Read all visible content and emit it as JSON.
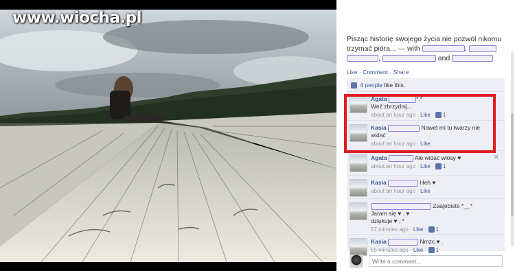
{
  "watermark": "www.wiocha.pl",
  "post": {
    "caption_line1": "Pisząc historię swojego życia nie pozwól nikomu",
    "caption_line2": "trzymać pióra... — with",
    "and_word": "and",
    "actions": {
      "like": "Like",
      "comment": "Comment",
      "share": "Share",
      "sep": "·"
    },
    "likes_count_link": "4 people",
    "likes_suffix": "like this."
  },
  "comments": [
    {
      "name": "Agata",
      "text": "*.*",
      "line2": "Weź zbrzydnij...",
      "time": "about an hour ago",
      "like": "Like",
      "likes": "1"
    },
    {
      "name": "Kasia",
      "text": "Nawet mi tu twarzy nie",
      "line2": "widać",
      "time": "about an hour ago",
      "like": "Like"
    },
    {
      "name": "Agata",
      "text": "Ale widać włosy ♥",
      "time": "about an hour ago",
      "like": "Like",
      "likes": "1"
    },
    {
      "name": "Kasia",
      "text": "Heh ♥",
      "time": "about an hour ago",
      "like": "Like"
    },
    {
      "name": "",
      "text": "Zaajebiste *__*",
      "line2": "Jaram się ♥ . ♥",
      "line3": "dziękuje ♥ ; *",
      "time": "57 minutes ago",
      "like": "Like",
      "likes": "1"
    },
    {
      "name": "Kasia",
      "text": "Nmzc ♥ .",
      "time": "55 minutes ago",
      "like": "Like",
      "likes": "1"
    }
  ],
  "write_comment": {
    "placeholder": "Write a comment..."
  },
  "icons": {
    "close": "close-icon",
    "thumb": "thumbs-up-icon"
  }
}
